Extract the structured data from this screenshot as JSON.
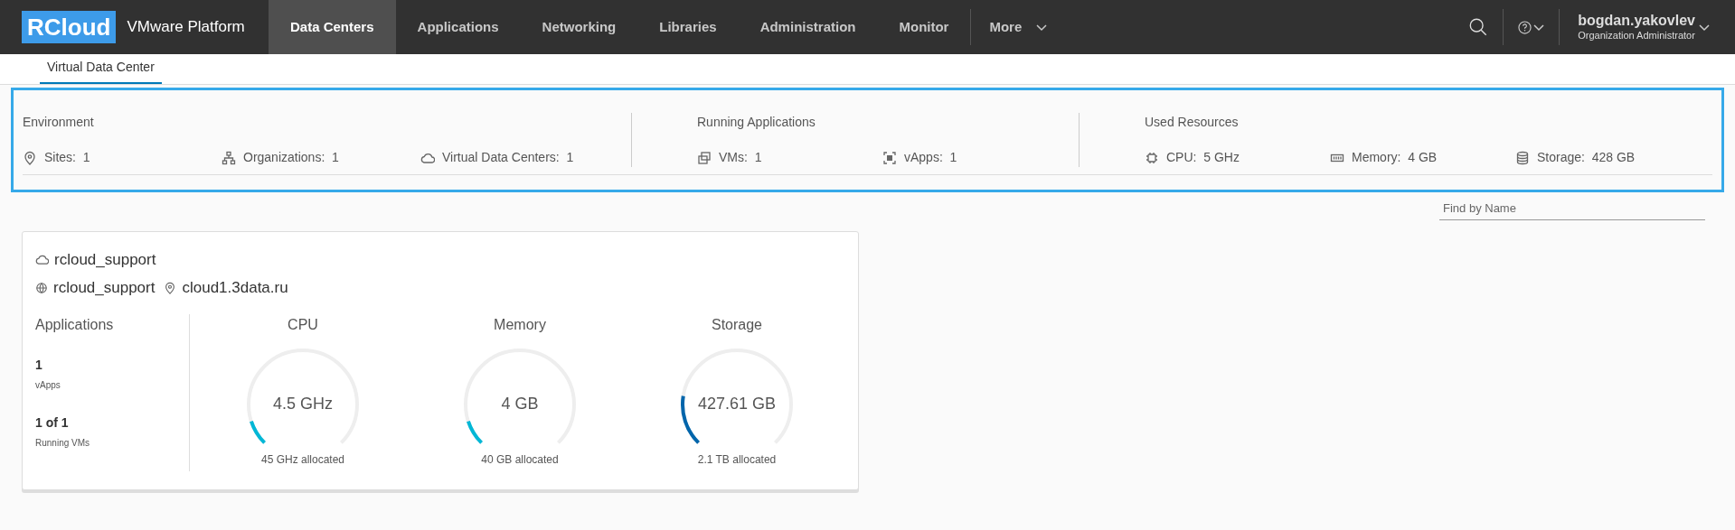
{
  "header": {
    "logo": "RCloud",
    "product": "VMware Platform",
    "nav": [
      {
        "label": "Data Centers",
        "selected": true
      },
      {
        "label": "Applications",
        "selected": false
      },
      {
        "label": "Networking",
        "selected": false
      },
      {
        "label": "Libraries",
        "selected": false
      },
      {
        "label": "Administration",
        "selected": false
      },
      {
        "label": "Monitor",
        "selected": false
      }
    ],
    "more": "More",
    "user": {
      "name": "bogdan.yakovlev",
      "role": "Organization Administrator"
    }
  },
  "subtabs": [
    {
      "label": "Virtual Data Center",
      "selected": true
    }
  ],
  "summary": [
    {
      "title": "Environment",
      "items": [
        {
          "kind": "pin",
          "label": "Sites:",
          "value": "1"
        },
        {
          "kind": "org",
          "label": "Organizations:",
          "value": "1"
        },
        {
          "kind": "cloud",
          "label": "Virtual Data Centers:",
          "value": "1"
        }
      ]
    },
    {
      "title": "Running Applications",
      "items": [
        {
          "kind": "vm",
          "label": "VMs:",
          "value": "1"
        },
        {
          "kind": "vapp",
          "label": "vApps:",
          "value": "1"
        }
      ]
    },
    {
      "title": "Used Resources",
      "items": [
        {
          "kind": "cpu",
          "label": "CPU:",
          "value": "5 GHz"
        },
        {
          "kind": "memory",
          "label": "Memory:",
          "value": "4 GB"
        },
        {
          "kind": "storage",
          "label": "Storage:",
          "value": "428 GB"
        }
      ]
    }
  ],
  "search": {
    "placeholder": "Find by Name"
  },
  "card": {
    "name": "rcloud_support",
    "org": "rcloud_support",
    "site": "cloud1.3data.ru",
    "applications": {
      "title": "Applications",
      "stats": [
        {
          "value": "1",
          "label": "vApps"
        },
        {
          "value": "1 of 1",
          "label": "Running VMs"
        }
      ]
    },
    "gauges": [
      {
        "title": "CPU",
        "value": "4.5 GHz",
        "allocated": "45 GHz allocated",
        "level": 0.1,
        "color": "#00b7d6"
      },
      {
        "title": "Memory",
        "value": "4 GB",
        "allocated": "40 GB allocated",
        "level": 0.1,
        "color": "#00b7d6"
      },
      {
        "title": "Storage",
        "value": "427.61 GB",
        "allocated": "2.1 TB allocated",
        "level": 0.2,
        "color": "#0065ab"
      }
    ]
  }
}
